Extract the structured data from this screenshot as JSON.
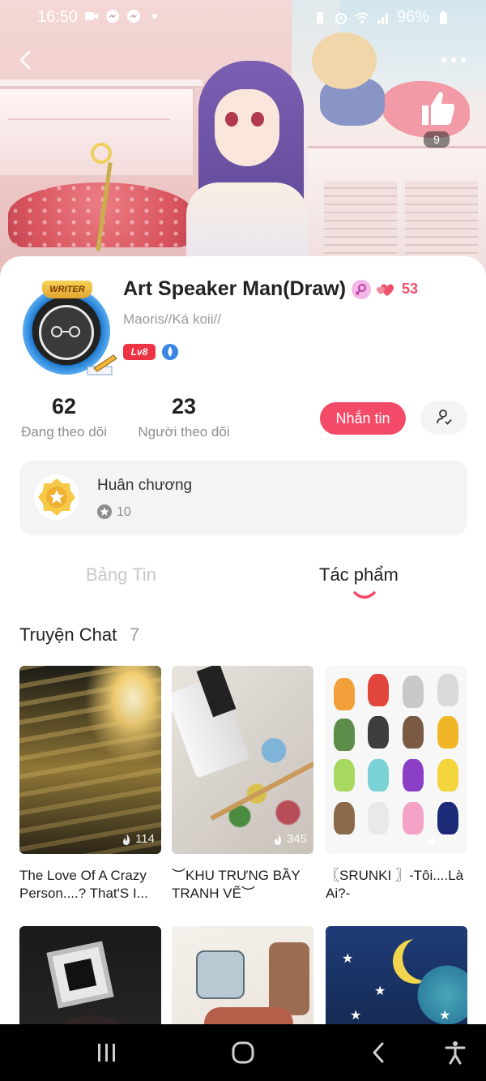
{
  "status_bar": {
    "time": "16:50",
    "battery_percent": "96%",
    "left_icons": [
      "video-icon",
      "messenger-icon",
      "messenger-icon",
      "dot-icon"
    ],
    "right_icons": [
      "battery-saver-icon",
      "alarm-icon",
      "wifi-icon",
      "signal-icon",
      "battery-icon"
    ]
  },
  "hero": {
    "like_count": "9"
  },
  "profile": {
    "username": "Art Speaker Man(Draw)",
    "hearts_count": "53",
    "handle": "Maoris//Ká koii//",
    "level": "Lv8",
    "avatar_tag": "WRITER",
    "stats": {
      "following_count": "62",
      "following_label": "Đang theo dõi",
      "followers_count": "23",
      "followers_label": "Người theo dõi"
    },
    "message_button": "Nhắn tin"
  },
  "medals": {
    "title": "Huân chương",
    "count": "10"
  },
  "tabs": [
    {
      "label": "Bảng Tin",
      "active": false
    },
    {
      "label": "Tác phẩm",
      "active": true
    }
  ],
  "section": {
    "title": "Truyện Chat",
    "count": "7"
  },
  "works": [
    {
      "title": "The Love Of A Crazy Person....? That'S I...",
      "views": "114"
    },
    {
      "title": "︶KHU TRƯNG BẦY TRANH VẼ︶",
      "views": "345"
    },
    {
      "title": "〖SRUNKI 〗-Tôi....Là Ai?-",
      "views": "275"
    },
    {
      "title": "",
      "views": ""
    },
    {
      "title": "",
      "views": ""
    },
    {
      "title": "",
      "views": ""
    }
  ],
  "colors": {
    "accent": "#f34a68",
    "level_badge": "#ee3344",
    "hearts": "#ef4f6b"
  }
}
